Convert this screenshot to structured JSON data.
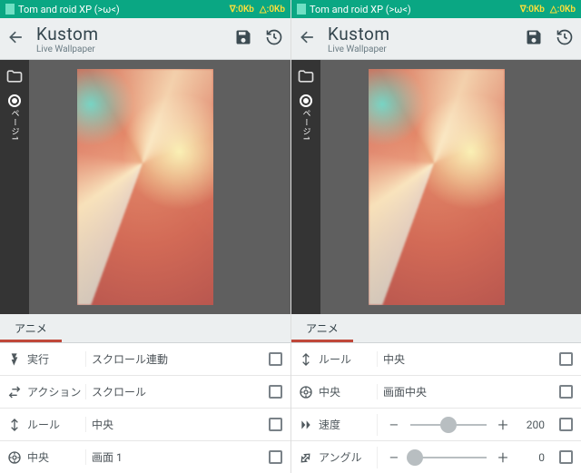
{
  "statusbar": {
    "title": "Tom and roid XP (>ω<)",
    "down": "∇:0Kb",
    "up": "△:0Kb"
  },
  "topbar": {
    "app": "Kustom",
    "sub": "Live Wallpaper"
  },
  "sidebar": {
    "page_label": "ページ1"
  },
  "tab": "アニメ",
  "left": {
    "rows": [
      {
        "label": "実行",
        "value": "スクロール連動"
      },
      {
        "label": "アクション",
        "value": "スクロール"
      },
      {
        "label": "ルール",
        "value": "中央"
      },
      {
        "label": "中央",
        "value": "画面 1"
      }
    ]
  },
  "right": {
    "rows": [
      {
        "label": "ルール",
        "value": "中央"
      },
      {
        "label": "中央",
        "value": "画面中央"
      }
    ],
    "sliders": [
      {
        "label": "速度",
        "value": "200",
        "pos": 50
      },
      {
        "label": "アングル",
        "value": "0",
        "pos": 6
      }
    ]
  }
}
